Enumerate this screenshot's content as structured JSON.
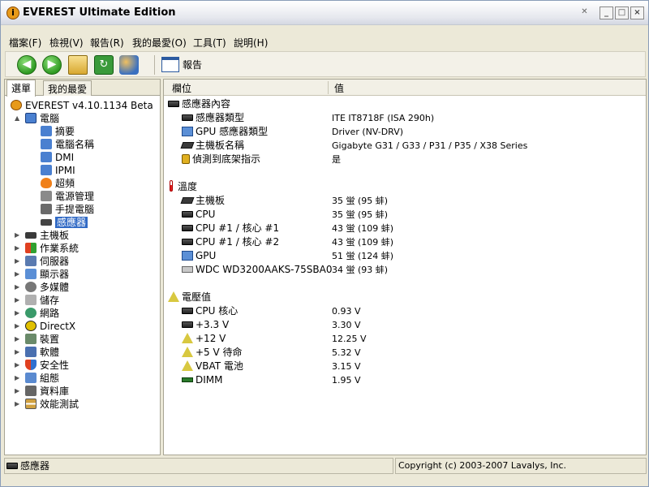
{
  "window": {
    "title": "EVEREST Ultimate Edition"
  },
  "menu": [
    "檔案(F)",
    "檢視(V)",
    "報告(R)",
    "我的最愛(O)",
    "工具(T)",
    "說明(H)"
  ],
  "toolbar": {
    "report_label": "報告"
  },
  "left": {
    "tabs": [
      "選單",
      "我的最愛"
    ],
    "root": "EVEREST v4.10.1134 Beta",
    "computer": "電腦",
    "computer_children": [
      "摘要",
      "電腦名稱",
      "DMI",
      "IPMI",
      "超頻",
      "電源管理",
      "手提電腦",
      "感應器"
    ],
    "top_items": [
      "主機板",
      "作業系統",
      "伺服器",
      "顯示器",
      "多媒體",
      "儲存",
      "網路",
      "DirectX",
      "裝置",
      "軟體",
      "安全性",
      "組態",
      "資料庫",
      "效能測試"
    ]
  },
  "right": {
    "col_field": "欄位",
    "col_value": "值",
    "sections": [
      {
        "title": "感應器內容",
        "rows": [
          {
            "name": "感應器類型",
            "value": "ITE IT8718F  (ISA 290h)"
          },
          {
            "name": "GPU 感應器類型",
            "value": "Driver  (NV-DRV)"
          },
          {
            "name": "主機板名稱",
            "value": "Gigabyte G31 / G33 / P31 / P35 / X38 Series"
          },
          {
            "name": "偵測到底架指示",
            "value": "是"
          }
        ]
      },
      {
        "title": "溫度",
        "rows": [
          {
            "name": "主機板",
            "value": "35 蛍  (95 蚌)"
          },
          {
            "name": "CPU",
            "value": "35 蛍  (95 蚌)"
          },
          {
            "name": "CPU #1 / 核心 #1",
            "value": "43 蛍  (109 蚌)"
          },
          {
            "name": "CPU #1 / 核心 #2",
            "value": "43 蛍  (109 蚌)"
          },
          {
            "name": "GPU",
            "value": "51 蛍  (124 蚌)"
          },
          {
            "name": "WDC WD3200AAKS-75SBA0",
            "value": "34 蛍  (93 蚌)"
          }
        ]
      },
      {
        "title": "電壓值",
        "rows": [
          {
            "name": "CPU 核心",
            "value": "0.93 V"
          },
          {
            "name": "+3.3 V",
            "value": "3.30 V"
          },
          {
            "name": "+12 V",
            "value": "12.25 V"
          },
          {
            "name": "+5 V 待命",
            "value": "5.32 V"
          },
          {
            "name": "VBAT 電池",
            "value": "3.15 V"
          },
          {
            "name": "DIMM",
            "value": "1.95 V"
          }
        ]
      }
    ]
  },
  "status": {
    "left": "感應器",
    "right": "Copyright (c) 2003-2007 Lavalys, Inc."
  }
}
